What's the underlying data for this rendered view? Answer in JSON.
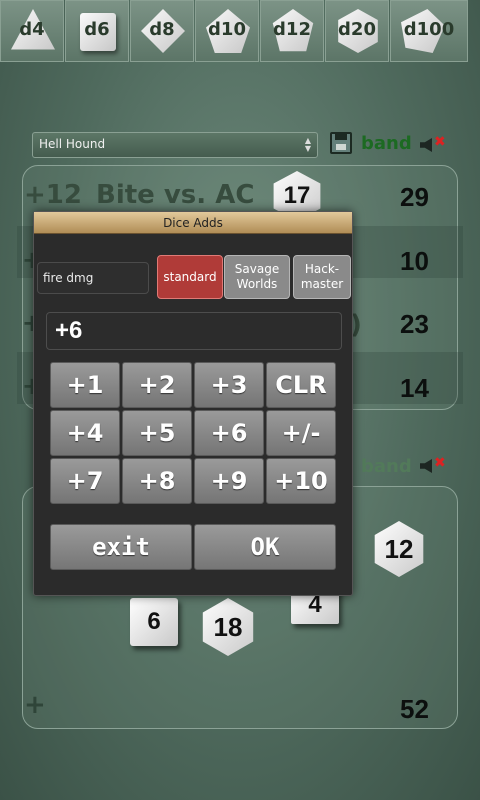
{
  "dice_bar": [
    "d4",
    "d6",
    "d8",
    "d10",
    "d12",
    "d20",
    "d100"
  ],
  "header": {
    "monster": "Hell Hound",
    "group_label": "band"
  },
  "attacks": [
    {
      "prefix": "+12",
      "name": "Bite vs. AC",
      "roll": "17",
      "total": "29"
    },
    {
      "total": "10"
    },
    {
      "partial": ")",
      "total": "23"
    },
    {
      "total": "14"
    }
  ],
  "group2": {
    "group_label": "band",
    "dice": [
      "12",
      "4",
      "6",
      "18"
    ],
    "total": "52"
  },
  "dialog": {
    "title": "Dice Adds",
    "name_value": "fire dmg",
    "modes": {
      "standard": "standard",
      "savage": "Savage Worlds",
      "hack": "Hack-master"
    },
    "display": "+6",
    "keys": [
      "+1",
      "+2",
      "+3",
      "CLR",
      "+4",
      "+5",
      "+6",
      "+/-",
      "+7",
      "+8",
      "+9",
      "+10"
    ],
    "exit_label": "exit",
    "ok_label": "OK"
  }
}
